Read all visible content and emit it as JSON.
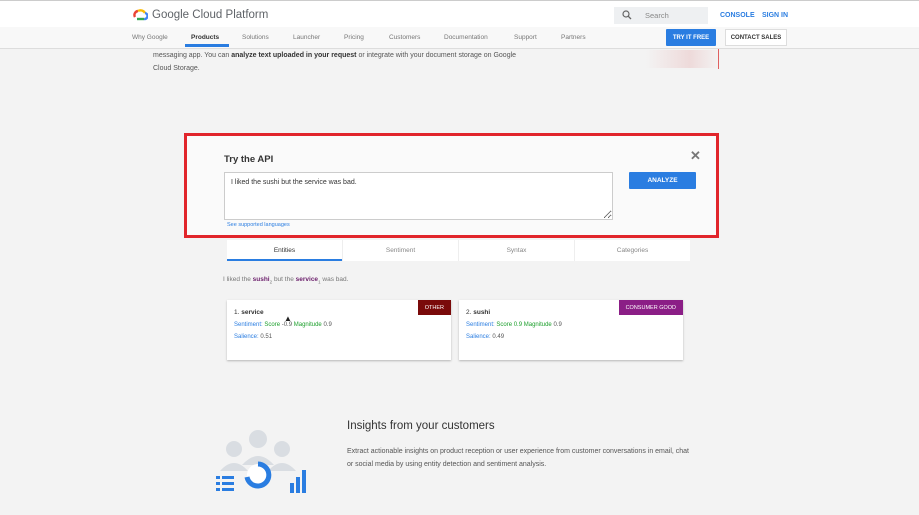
{
  "header": {
    "logo_text": "Google Cloud Platform",
    "search_placeholder": "Search",
    "console_label": "CONSOLE",
    "signin_label": "SIGN IN"
  },
  "nav": {
    "items": [
      {
        "label": "Why Google"
      },
      {
        "label": "Products"
      },
      {
        "label": "Solutions"
      },
      {
        "label": "Launcher"
      },
      {
        "label": "Pricing"
      },
      {
        "label": "Customers"
      },
      {
        "label": "Documentation"
      },
      {
        "label": "Support"
      },
      {
        "label": "Partners"
      }
    ],
    "active": "Products",
    "try_free_label": "TRY IT FREE",
    "contact_sales_label": "CONTACT SALES"
  },
  "intro": {
    "line1_a": "messaging app. You can ",
    "line1_b": "analyze text uploaded in your request",
    "line1_c": " or integrate with your document storage on Google",
    "line2": "Cloud Storage."
  },
  "api": {
    "title": "Try the API",
    "input_value": "I liked the sushi but the service was bad.",
    "analyze_label": "ANALYZE",
    "languages_link": "See supported languages"
  },
  "tabs": [
    {
      "label": "Entities"
    },
    {
      "label": "Sentiment"
    },
    {
      "label": "Syntax"
    },
    {
      "label": "Categories"
    }
  ],
  "sentence": {
    "p1": "I liked the ",
    "e1": "sushi",
    "e1_index": "2",
    "p2": " but the ",
    "e2": "service",
    "e2_index": "1",
    "p3": " was bad."
  },
  "entities": [
    {
      "index": "1.",
      "name": "service",
      "type": "OTHER",
      "type_color": "#7a0a0a",
      "sentiment_label": "Sentiment:",
      "score_label": "Score",
      "score": "-0.9",
      "magnitude_label": "Magnitude",
      "magnitude": "0.9",
      "salience_label": "Salience:",
      "salience": "0.51"
    },
    {
      "index": "2.",
      "name": "sushi",
      "type": "CONSUMER GOOD",
      "type_color": "#8b1e86",
      "sentiment_label": "Sentiment:",
      "score_label": "Score",
      "score": "0.9",
      "magnitude_label": "Magnitude",
      "magnitude": "0.9",
      "salience_label": "Salience:",
      "salience": "0.49"
    }
  ],
  "insights": {
    "title": "Insights from your customers",
    "body": "Extract actionable insights on product reception or user experience from customer conversations in email, chat or social media by using entity detection and sentiment analysis."
  },
  "colors": {
    "accent": "#2a7de1",
    "highlight_border": "#e1252b",
    "positive": "#1a9e2a"
  }
}
